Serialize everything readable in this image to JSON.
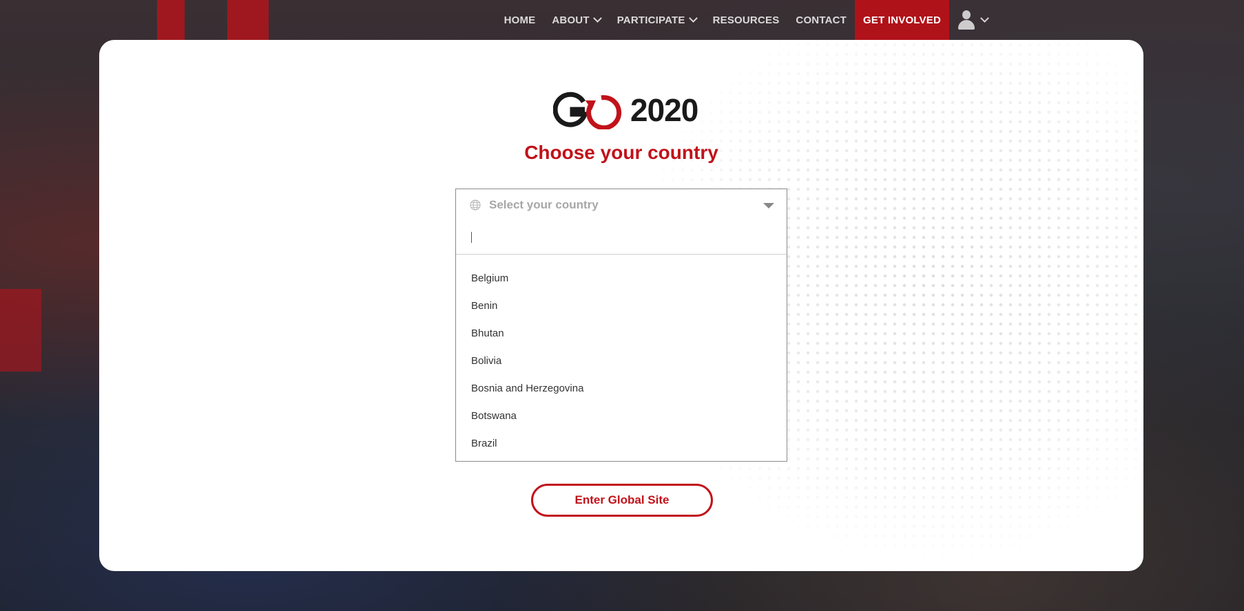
{
  "nav": {
    "items": [
      {
        "label": "HOME",
        "has_dropdown": false
      },
      {
        "label": "ABOUT",
        "has_dropdown": true
      },
      {
        "label": "PARTICIPATE",
        "has_dropdown": true
      },
      {
        "label": "RESOURCES",
        "has_dropdown": false
      },
      {
        "label": "CONTACT",
        "has_dropdown": false
      }
    ],
    "cta_label": "GET INVOLVED",
    "user_icon": "user-icon"
  },
  "logo": {
    "brand": "GO",
    "year": "2020"
  },
  "main": {
    "title": "Choose your country",
    "select": {
      "placeholder": "Select your country",
      "icon": "globe-icon",
      "search_value": ""
    },
    "options": [
      "Belgium",
      "Benin",
      "Bhutan",
      "Bolivia",
      "Bosnia and Herzegovina",
      "Botswana",
      "Brazil"
    ],
    "enter_button_label": "Enter Global Site"
  },
  "colors": {
    "brand_red": "#c1121a",
    "nav_cta_bg": "#b01219"
  }
}
